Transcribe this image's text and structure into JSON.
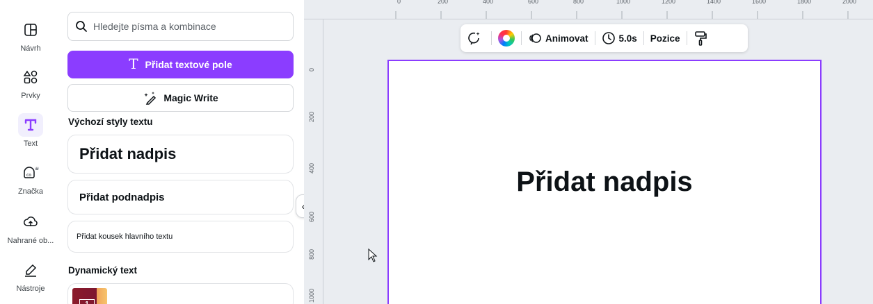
{
  "rail": {
    "items": [
      {
        "label": "Návrh",
        "icon": "layout-icon",
        "active": false
      },
      {
        "label": "Prvky",
        "icon": "shapes-icon",
        "active": false
      },
      {
        "label": "Text",
        "icon": "text-icon",
        "active": true
      },
      {
        "label": "Značka",
        "icon": "brand-icon",
        "active": false
      },
      {
        "label": "Nahrané ob...",
        "icon": "upload-icon",
        "active": false
      },
      {
        "label": "Nástroje",
        "icon": "tools-icon",
        "active": false
      }
    ]
  },
  "panel": {
    "search_placeholder": "Hledejte písma a kombinace",
    "add_textbox_label": "Přidat textové pole",
    "magic_write_label": "Magic Write",
    "default_styles_title": "Výchozí styly textu",
    "heading_label": "Přidat nadpis",
    "subheading_label": "Přidat podnadpis",
    "body_label": "Přidat kousek hlavního textu",
    "dynamic_text_title": "Dynamický text",
    "dynamic_thumb_label": "1"
  },
  "toolbar": {
    "animate_label": "Animovat",
    "duration_label": "5.0s",
    "position_label": "Pozice"
  },
  "canvas": {
    "heading_text": "Přidat nadpis"
  },
  "ruler": {
    "top_labels": [
      "0",
      "200",
      "400",
      "600",
      "800",
      "1000",
      "1200",
      "1400",
      "1600",
      "1800",
      "2000"
    ],
    "left_labels": [
      "0",
      "200",
      "400",
      "600",
      "800",
      "1000"
    ]
  },
  "colors": {
    "accent": "#8b3dff",
    "workspace_bg": "#eaedf1"
  }
}
